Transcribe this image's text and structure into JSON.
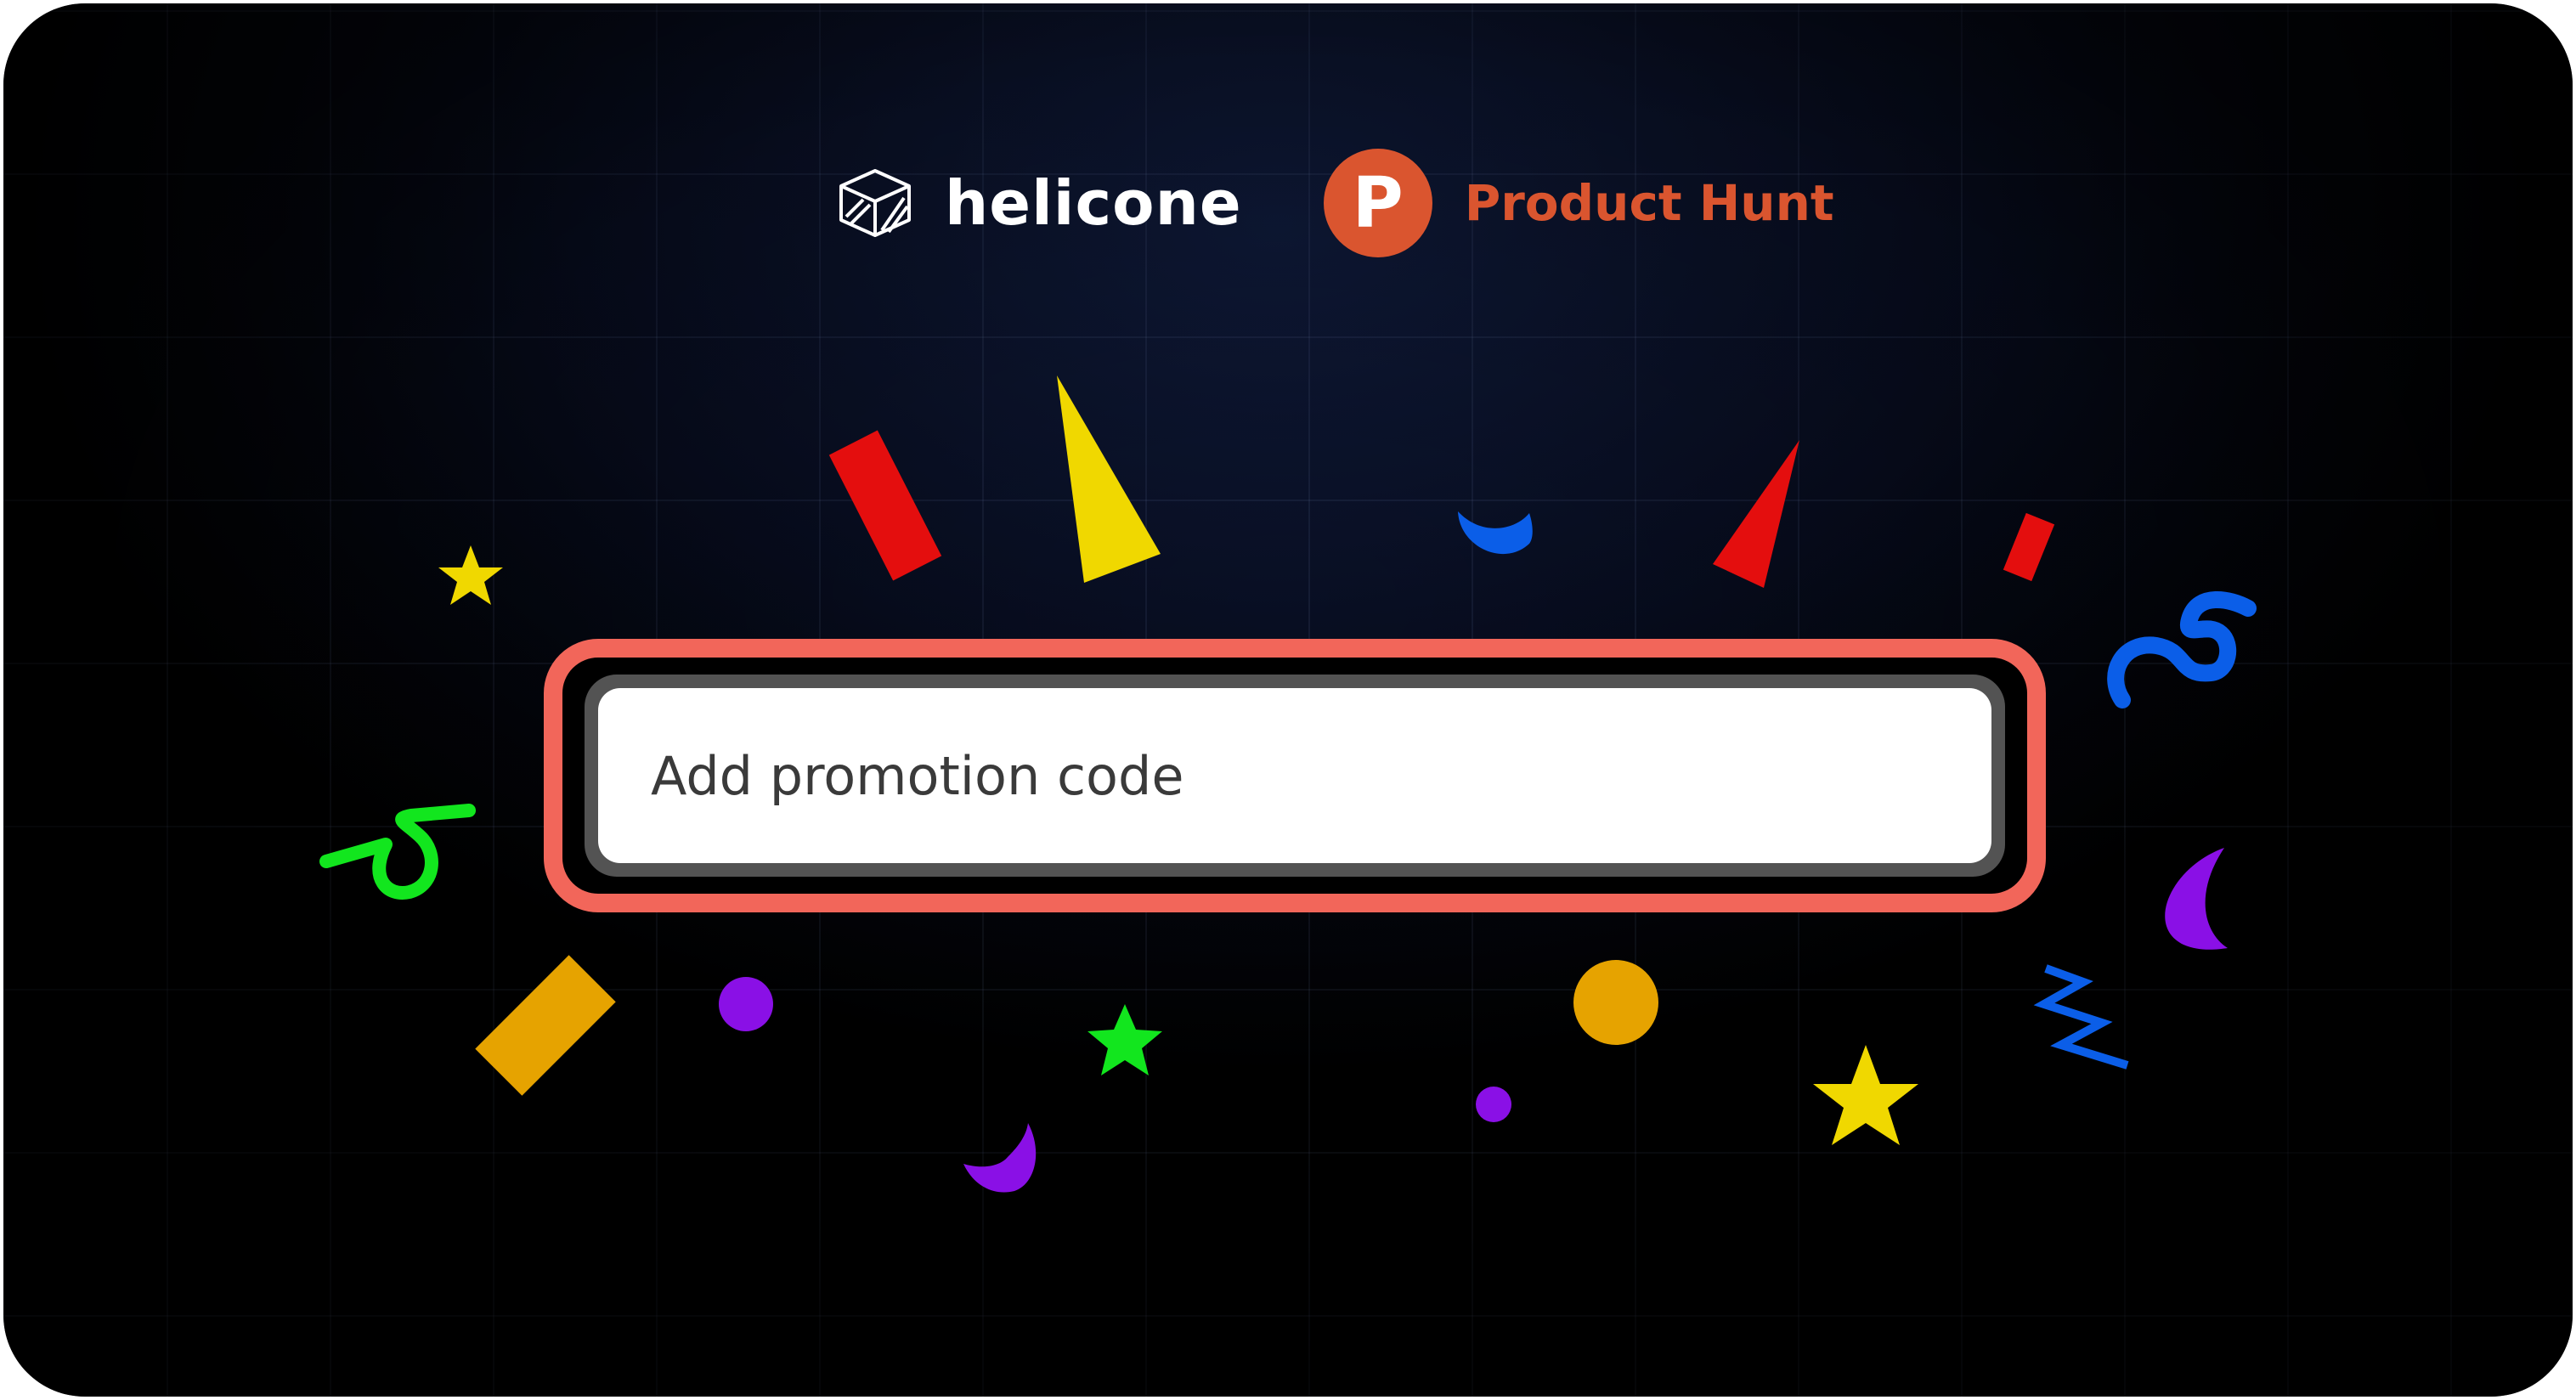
{
  "brands": {
    "helicone": {
      "name": "helicone",
      "icon": "helicone-cube-icon"
    },
    "product_hunt": {
      "name": "Product Hunt",
      "badge_letter": "P",
      "icon": "product-hunt-icon",
      "color": "#da552f"
    }
  },
  "promo": {
    "placeholder": "Add promotion code",
    "highlight_color": "#f2665a"
  },
  "confetti_colors": {
    "red": "#e40e0e",
    "yellow": "#f0d800",
    "blue": "#0b5ee8",
    "purple": "#8a10e6",
    "green": "#12e61e",
    "orange": "#e6a300"
  }
}
